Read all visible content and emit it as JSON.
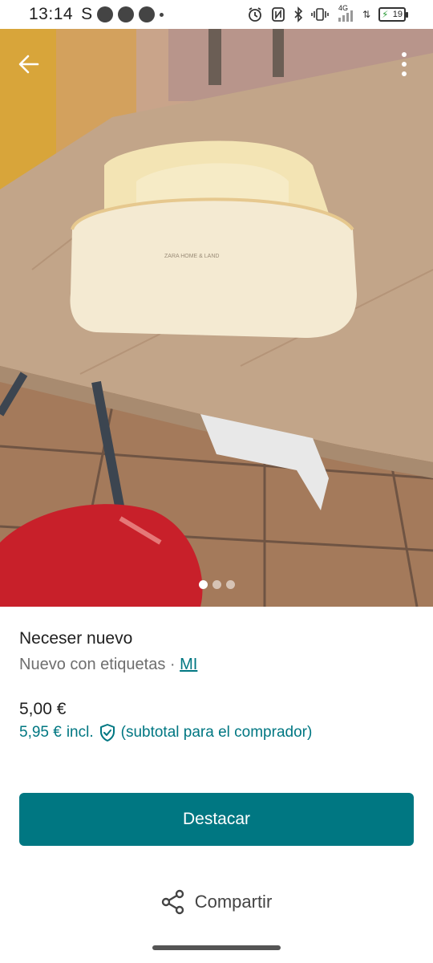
{
  "status_bar": {
    "time": "13:14",
    "carrier_glyph": "S",
    "network": "4G",
    "battery_level": "19"
  },
  "photo": {
    "image_count": 3,
    "active_index": 0,
    "embroidered_text": "ZARA HOME & LAND"
  },
  "item": {
    "title": "Neceser nuevo",
    "condition": "Nuevo con etiquetas",
    "separator": " · ",
    "brand": "MI",
    "price": "5,00 €",
    "buyer_price": "5,95 €",
    "incl_label": "incl.",
    "buyer_note": "(subtotal para el comprador)"
  },
  "actions": {
    "primary_label": "Destacar",
    "share_label": "Compartir"
  },
  "colors": {
    "accent": "#007782",
    "text": "#1f1f1f",
    "muted": "#6e6e6e"
  }
}
